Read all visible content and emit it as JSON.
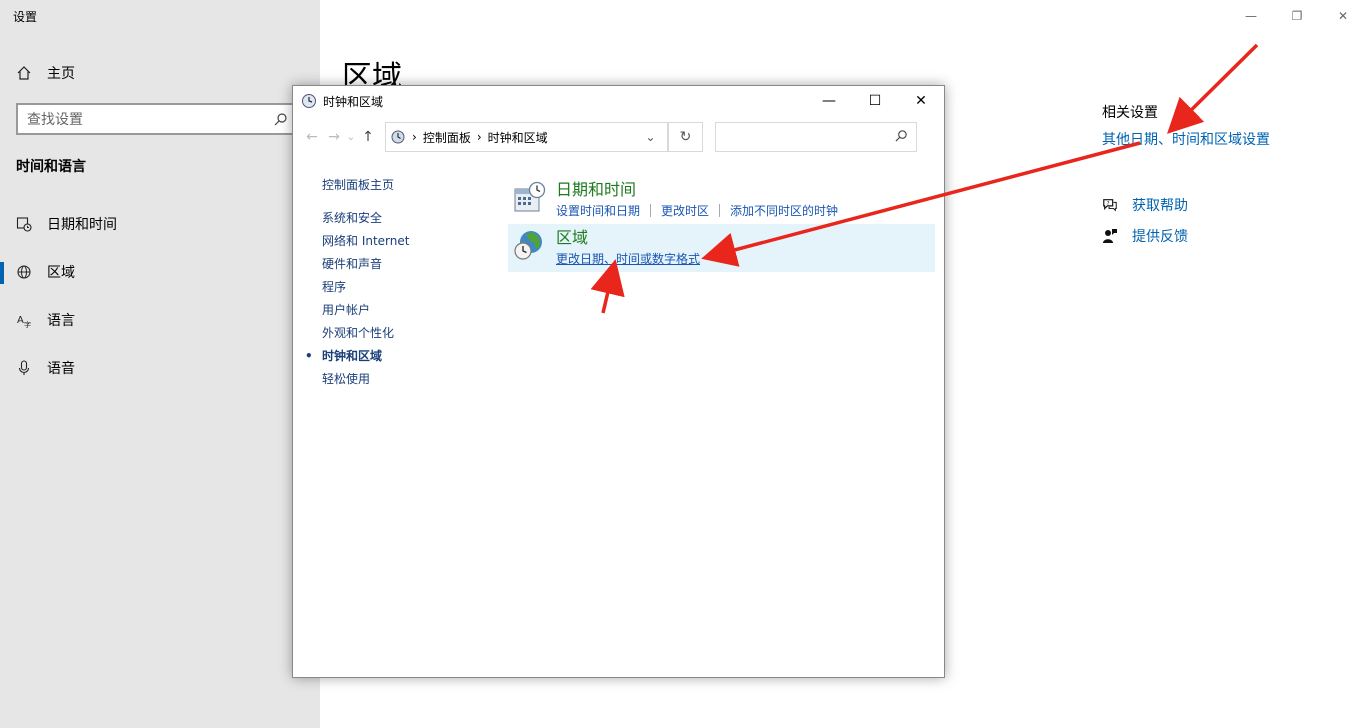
{
  "settings": {
    "app_title": "设置",
    "home": "主页",
    "search_placeholder": "查找设置",
    "section": "时间和语言",
    "nav": [
      "日期和时间",
      "区域",
      "语言",
      "语音"
    ],
    "page_title": "区域",
    "related_heading": "相关设置",
    "related_link": "其他日期、时间和区域设置",
    "get_help": "获取帮助",
    "feedback": "提供反馈"
  },
  "control_panel": {
    "title": "时钟和区域",
    "breadcrumb": [
      "控制面板",
      "时钟和区域"
    ],
    "left_home": "控制面板主页",
    "left_links": [
      "系统和安全",
      "网络和 Internet",
      "硬件和声音",
      "程序",
      "用户帐户",
      "外观和个性化",
      "时钟和区域",
      "轻松使用"
    ],
    "items": [
      {
        "title": "日期和时间",
        "links": [
          "设置时间和日期",
          "更改时区",
          "添加不同时区的时钟"
        ]
      },
      {
        "title": "区域",
        "links": [
          "更改日期、时间或数字格式"
        ]
      }
    ]
  },
  "colors": {
    "accent": "#0063b1",
    "annotation_arrow": "#e8261c",
    "highlight": "#e5f3fb"
  }
}
